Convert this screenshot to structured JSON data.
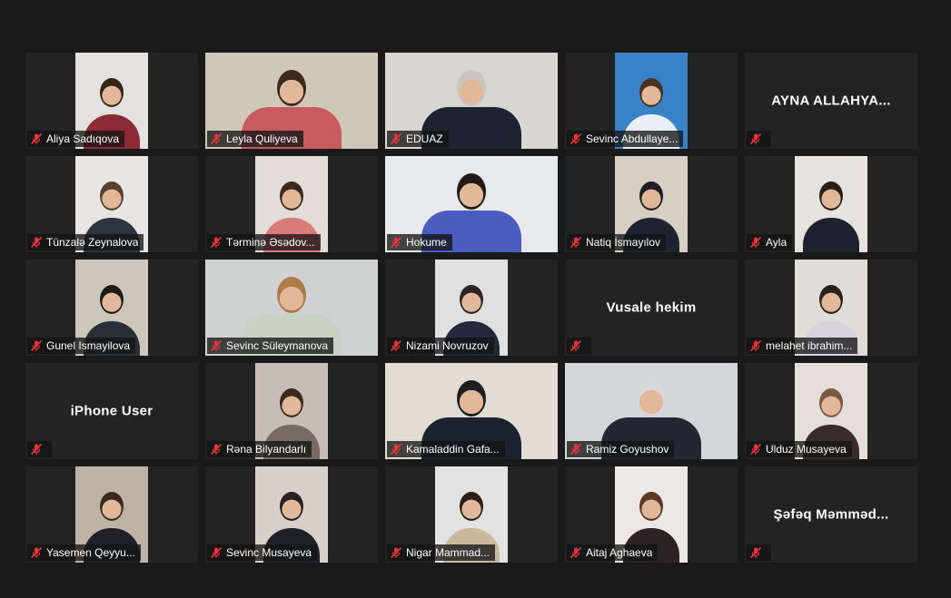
{
  "meeting": {
    "participants": [
      {
        "name": "Aliya Sadıqova",
        "show_video": true,
        "wide": false,
        "wall": "#e4e2de",
        "hair": "#3a2418",
        "cloth": "#8c2b36"
      },
      {
        "name": "Leyla Quliyeva",
        "show_video": true,
        "wide": true,
        "wall": "#cfc7b8",
        "hair": "#3b2a20",
        "cloth": "#c85b5f"
      },
      {
        "name": "EDUAZ",
        "show_video": true,
        "wide": true,
        "wall": "#d8d6d2",
        "hair": "#c9c4bd",
        "cloth": "#1d2330"
      },
      {
        "name": "Sevinc Abdullayeva",
        "display": "Sevinc Abdullaye...",
        "show_video": true,
        "wide": false,
        "wall": "#3a82c8",
        "hair": "#4a3223",
        "cloth": "#e8eef6"
      },
      {
        "name": "AYNA ALLAHYA...",
        "show_video": false
      },
      {
        "name": "Tünzalə Zeynalova",
        "show_video": true,
        "wide": false,
        "wall": "#e8e6e4",
        "hair": "#5a4030",
        "cloth": "#2c3440"
      },
      {
        "name": "Tərminə Əsədova",
        "display": "Tərminə Əsədov...",
        "show_video": true,
        "wide": false,
        "wall": "#e2ddd6",
        "hair": "#3b2a20",
        "cloth": "#d97b78"
      },
      {
        "name": "Hokume",
        "show_video": true,
        "wide": true,
        "wall": "#e7e9ea",
        "hair": "#241a15",
        "cloth": "#4b5cc0"
      },
      {
        "name": "Natiq İsmayılov",
        "show_video": true,
        "wide": false,
        "wall": "#d6d0c4",
        "hair": "#1e1e22",
        "cloth": "#1d2330"
      },
      {
        "name": "Ayla",
        "show_video": true,
        "wide": false,
        "wall": "#e6e3de",
        "hair": "#2a1d18",
        "cloth": "#1f2030"
      },
      {
        "name": "Gunel Ismayilova",
        "show_video": true,
        "wide": false,
        "wall": "#cdc7bb",
        "hair": "#1e1a18",
        "cloth": "#2a2e38"
      },
      {
        "name": "Sevinc Süleymanova",
        "show_video": true,
        "wide": true,
        "active": true,
        "wall": "#cfd2d0",
        "hair": "#b07a48",
        "cloth": "#c8d2c2"
      },
      {
        "name": "Nizami Novruzov",
        "show_video": true,
        "wide": false,
        "wall": "#dfe0df",
        "hair": "#2a2426",
        "cloth": "#23283a"
      },
      {
        "name": "Vusale hekim",
        "show_video": false
      },
      {
        "name": "melahet ibrahimova",
        "display": "melahet ibrahim...",
        "show_video": true,
        "wide": false,
        "wall": "#e0dcd6",
        "hair": "#2a1e18",
        "cloth": "#d6d3dc"
      },
      {
        "name": "iPhone User",
        "show_video": false
      },
      {
        "name": "Rəna Bilyandarlı",
        "show_video": true,
        "wide": false,
        "wall": "#c7bdb4",
        "hair": "#3c2a22",
        "cloth": "#7a6a66"
      },
      {
        "name": "Kamaladdin Gafarov",
        "display": "Kamaladdin Gafa...",
        "show_video": true,
        "wide": true,
        "wall": "#e2ddd3",
        "hair": "#1e1e22",
        "cloth": "#1c2330"
      },
      {
        "name": "Ramiz Goyushov",
        "show_video": true,
        "wide": true,
        "wall": "#d4d6da",
        "hair": "#d8d8d8",
        "cloth": "#222833"
      },
      {
        "name": "Ulduz Musayeva",
        "show_video": true,
        "wide": false,
        "wall": "#e4dfd8",
        "hair": "#7a5a3e",
        "cloth": "#3a2c28"
      },
      {
        "name": "Yasemen Qeyyumova",
        "display": "Yasemen Qeyyu...",
        "show_video": true,
        "wide": false,
        "wall": "#bfb3a6",
        "hair": "#3a2a22",
        "cloth": "#1f2028"
      },
      {
        "name": "Sevinc Musayeva",
        "show_video": true,
        "wide": false,
        "wall": "#d8d0c8",
        "hair": "#2a2020",
        "cloth": "#1f2028"
      },
      {
        "name": "Nigar Mammadova",
        "display": "Nigar Mammad...",
        "show_video": true,
        "wide": false,
        "wall": "#e2e2e2",
        "hair": "#2a1e18",
        "cloth": "#c9b89c"
      },
      {
        "name": "Aitaj Aghaeva",
        "show_video": true,
        "wide": false,
        "wall": "#ece8e4",
        "hair": "#5a3a26",
        "cloth": "#2a2426"
      },
      {
        "name": "Şəfəq  Məmməd...",
        "show_video": false
      }
    ],
    "mic_muted_color": "#e8353a",
    "active_speaker_color": "#d8e36a"
  }
}
